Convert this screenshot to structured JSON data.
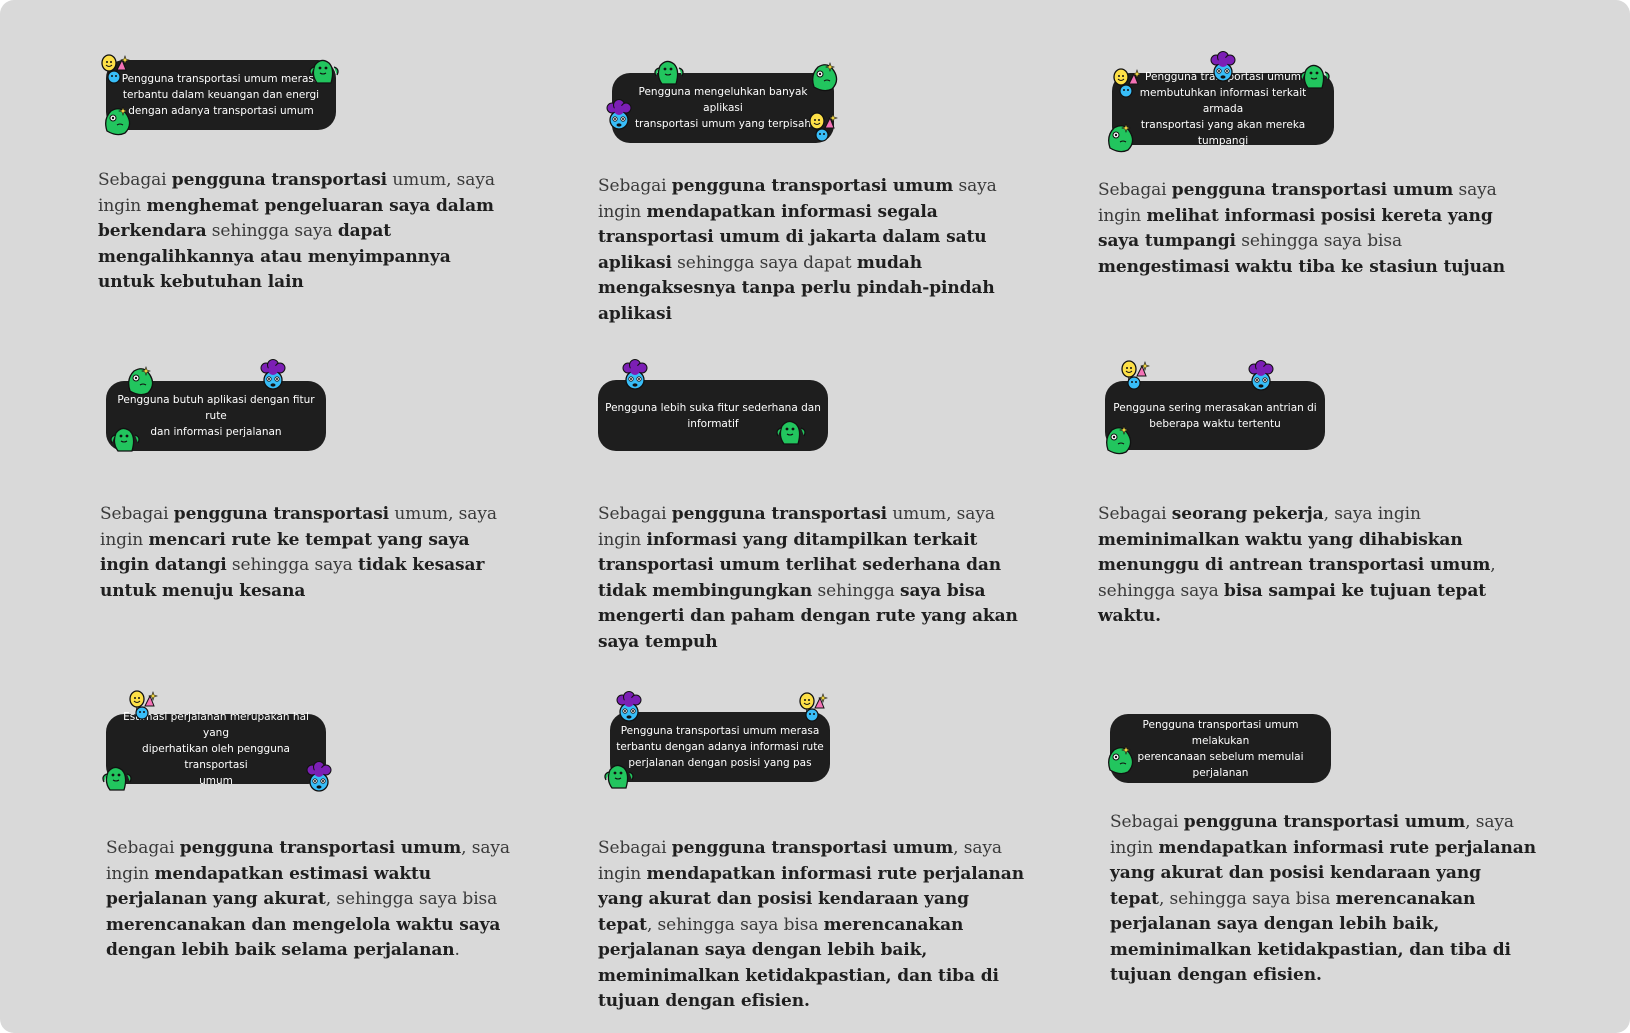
{
  "colors": {
    "background": "#d9d9d9",
    "pill": "#1e1e1e",
    "pill_text": "#ffffff",
    "story_text": "#3a3a3a",
    "sticker_green": "#22c55e",
    "sticker_purple": "#7c1fb5",
    "sticker_blue": "#38bdf8",
    "sticker_yellow": "#fde047"
  },
  "cards": [
    {
      "note": "Pengguna transportasi umum merasa\nterbantu dalam keuangan dan energi\ndengan adanya transportasi umum",
      "story": [
        {
          "t": "Sebagai "
        },
        {
          "t": "pengguna transportasi",
          "b": true
        },
        {
          "t": " umum, saya ingin "
        },
        {
          "t": "menghemat pengeluaran saya dalam berkendara",
          "b": true
        },
        {
          "t": " sehingga saya "
        },
        {
          "t": "dapat mengalihkannya atau menyimpannya untuk kebutuhan lain",
          "b": true
        }
      ]
    },
    {
      "note": "Pengguna mengeluhkan  banyak aplikasi\ntransportasi umum yang terpisah",
      "story": [
        {
          "t": "Sebagai "
        },
        {
          "t": "pengguna transportasi umum",
          "b": true
        },
        {
          "t": " saya ingin "
        },
        {
          "t": "mendapatkan informasi segala transportasi umum di jakarta dalam satu aplikasi",
          "b": true
        },
        {
          "t": " sehingga saya dapat "
        },
        {
          "t": "mudah mengaksesnya tanpa perlu pindah-pindah aplikasi",
          "b": true
        }
      ]
    },
    {
      "note": "Pengguna transportasi umum\nmembutuhkan informasi terkait armada\ntransportasi yang akan mereka tumpangi",
      "story": [
        {
          "t": "Sebagai "
        },
        {
          "t": "pengguna transportasi umum",
          "b": true
        },
        {
          "t": " saya ingin "
        },
        {
          "t": "melihat informasi posisi kereta yang saya tumpangi",
          "b": true
        },
        {
          "t": " sehingga saya bisa "
        },
        {
          "t": "mengestimasi waktu tiba ke stasiun tujuan",
          "b": true
        }
      ]
    },
    {
      "note": "Pengguna butuh aplikasi dengan fitur rute\ndan informasi perjalanan",
      "story": [
        {
          "t": "Sebagai "
        },
        {
          "t": "pengguna transportasi",
          "b": true
        },
        {
          "t": " umum, saya ingin "
        },
        {
          "t": "mencari rute ke tempat yang saya ingin datangi",
          "b": true
        },
        {
          "t": " sehingga saya "
        },
        {
          "t": "tidak kesasar untuk menuju kesana",
          "b": true
        }
      ]
    },
    {
      "note": "Pengguna lebih suka fitur sederhana dan\ninformatif",
      "story": [
        {
          "t": "Sebagai "
        },
        {
          "t": "pengguna transportasi",
          "b": true
        },
        {
          "t": " umum, saya ingin "
        },
        {
          "t": "informasi yang ditampilkan terkait transportasi umum terlihat sederhana dan tidak membingungkan",
          "b": true
        },
        {
          "t": " sehingga "
        },
        {
          "t": "saya bisa mengerti dan paham dengan rute yang akan saya tempuh",
          "b": true
        }
      ]
    },
    {
      "note": "Pengguna sering merasakan antrian di\nbeberapa waktu tertentu",
      "story": [
        {
          "t": "Sebagai "
        },
        {
          "t": "seorang pekerja",
          "b": true
        },
        {
          "t": ", saya ingin "
        },
        {
          "t": "meminimalkan waktu yang dihabiskan menunggu di antrean transportasi umum",
          "b": true
        },
        {
          "t": ", sehingga saya "
        },
        {
          "t": "bisa sampai ke tujuan tepat waktu.",
          "b": true
        }
      ]
    },
    {
      "note": "Estimasi perjalanan merupakan hal yang\ndiperhatikan oleh pengguna transportasi\numum",
      "story": [
        {
          "t": "Sebagai "
        },
        {
          "t": "pengguna transportasi umum",
          "b": true
        },
        {
          "t": ", saya ingin "
        },
        {
          "t": "mendapatkan estimasi waktu perjalanan yang akurat",
          "b": true
        },
        {
          "t": ", sehingga saya bisa "
        },
        {
          "t": "merencanakan dan mengelola waktu saya dengan lebih baik selama perjalanan",
          "b": true
        },
        {
          "t": "."
        }
      ]
    },
    {
      "note": "Pengguna transportasi umum merasa\nterbantu dengan adanya informasi rute\nperjalanan dengan posisi yang pas",
      "story": [
        {
          "t": "Sebagai "
        },
        {
          "t": "pengguna transportasi umum",
          "b": true
        },
        {
          "t": ", saya ingin "
        },
        {
          "t": "mendapatkan informasi rute perjalanan yang akurat dan posisi kendaraan yang tepat",
          "b": true
        },
        {
          "t": ", sehingga saya bisa "
        },
        {
          "t": "merencanakan perjalanan saya dengan lebih baik, meminimalkan ketidakpastian, dan tiba di tujuan dengan efisien.",
          "b": true
        }
      ]
    },
    {
      "note": "Pengguna transportasi umum melakukan\nperencanaan sebelum memulai\nperjalanan",
      "story": [
        {
          "t": "Sebagai "
        },
        {
          "t": "pengguna transportasi umum",
          "b": true
        },
        {
          "t": ", saya ingin "
        },
        {
          "t": "mendapatkan informasi rute perjalanan yang akurat dan posisi kendaraan yang tepat",
          "b": true
        },
        {
          "t": ", sehingga saya bisa "
        },
        {
          "t": "merencanakan perjalanan saya dengan lebih baik, meminimalkan ketidakpastian, dan tiba di tujuan dengan efisien.",
          "b": true
        }
      ]
    }
  ]
}
